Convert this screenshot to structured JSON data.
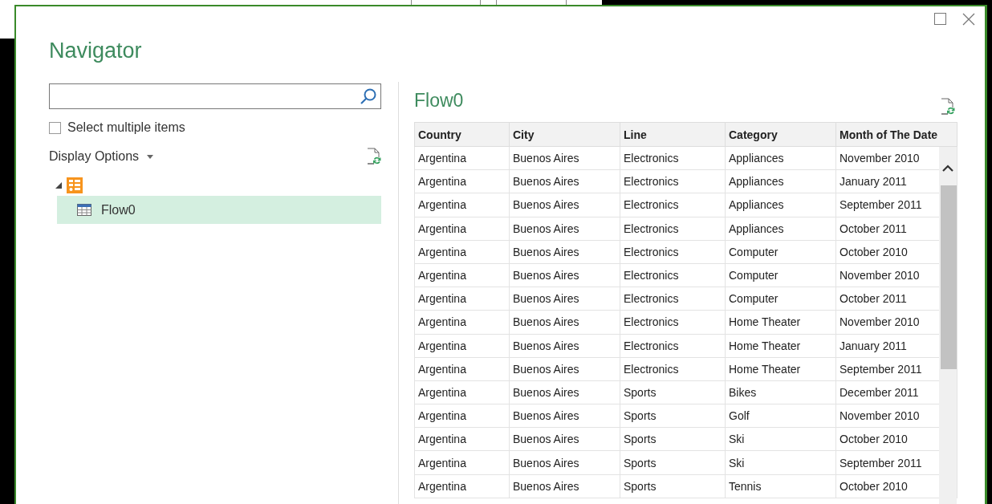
{
  "dialog": {
    "title": "Navigator"
  },
  "select_multiple": {
    "label": "Select multiple items",
    "checked": false
  },
  "display_options": {
    "label": "Display Options"
  },
  "tree": [
    {
      "expanded": true,
      "children": [
        {
          "label": "Flow0",
          "selected": true
        }
      ]
    }
  ],
  "preview": {
    "title": "Flow0",
    "columns": [
      "Country",
      "City",
      "Line",
      "Category",
      "Month of The Date"
    ],
    "rows": [
      [
        "Argentina",
        "Buenos Aires",
        "Electronics",
        "Appliances",
        "November 2010"
      ],
      [
        "Argentina",
        "Buenos Aires",
        "Electronics",
        "Appliances",
        "January 2011"
      ],
      [
        "Argentina",
        "Buenos Aires",
        "Electronics",
        "Appliances",
        "September 2011"
      ],
      [
        "Argentina",
        "Buenos Aires",
        "Electronics",
        "Appliances",
        "October 2011"
      ],
      [
        "Argentina",
        "Buenos Aires",
        "Electronics",
        "Computer",
        "October 2010"
      ],
      [
        "Argentina",
        "Buenos Aires",
        "Electronics",
        "Computer",
        "November 2010"
      ],
      [
        "Argentina",
        "Buenos Aires",
        "Electronics",
        "Computer",
        "October 2011"
      ],
      [
        "Argentina",
        "Buenos Aires",
        "Electronics",
        "Home Theater",
        "November 2010"
      ],
      [
        "Argentina",
        "Buenos Aires",
        "Electronics",
        "Home Theater",
        "January 2011"
      ],
      [
        "Argentina",
        "Buenos Aires",
        "Electronics",
        "Home Theater",
        "September 2011"
      ],
      [
        "Argentina",
        "Buenos Aires",
        "Sports",
        "Bikes",
        "December 2011"
      ],
      [
        "Argentina",
        "Buenos Aires",
        "Sports",
        "Golf",
        "November 2010"
      ],
      [
        "Argentina",
        "Buenos Aires",
        "Sports",
        "Ski",
        "October 2010"
      ],
      [
        "Argentina",
        "Buenos Aires",
        "Sports",
        "Ski",
        "September 2011"
      ],
      [
        "Argentina",
        "Buenos Aires",
        "Sports",
        "Tennis",
        "October 2010"
      ]
    ]
  }
}
